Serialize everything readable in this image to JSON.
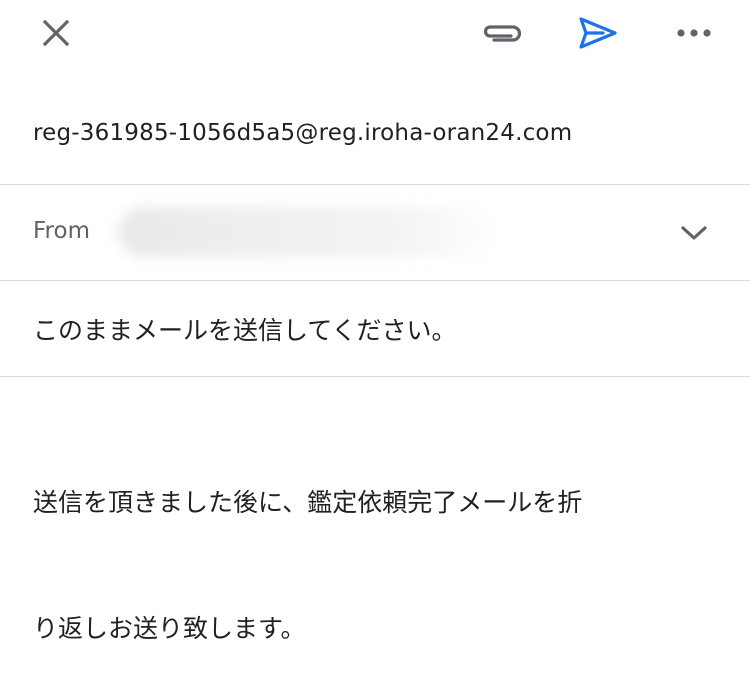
{
  "toolbar": {
    "close_icon": "close-icon",
    "attach_icon": "paperclip-icon",
    "send_icon": "send-icon",
    "more_icon": "more-horizontal-icon",
    "send_color": "#1a73e8",
    "icon_color": "#5f6368"
  },
  "compose": {
    "to_value": "reg-361985-1056d5a5@reg.iroha-oran24.com",
    "from_label": "From",
    "from_value_redacted": true,
    "subject": "このままメールを送信してください。",
    "body_line1": "送信を頂きました後に、鑑定依頼完了メールを折",
    "body_line2": "り返しお送り致します。"
  }
}
